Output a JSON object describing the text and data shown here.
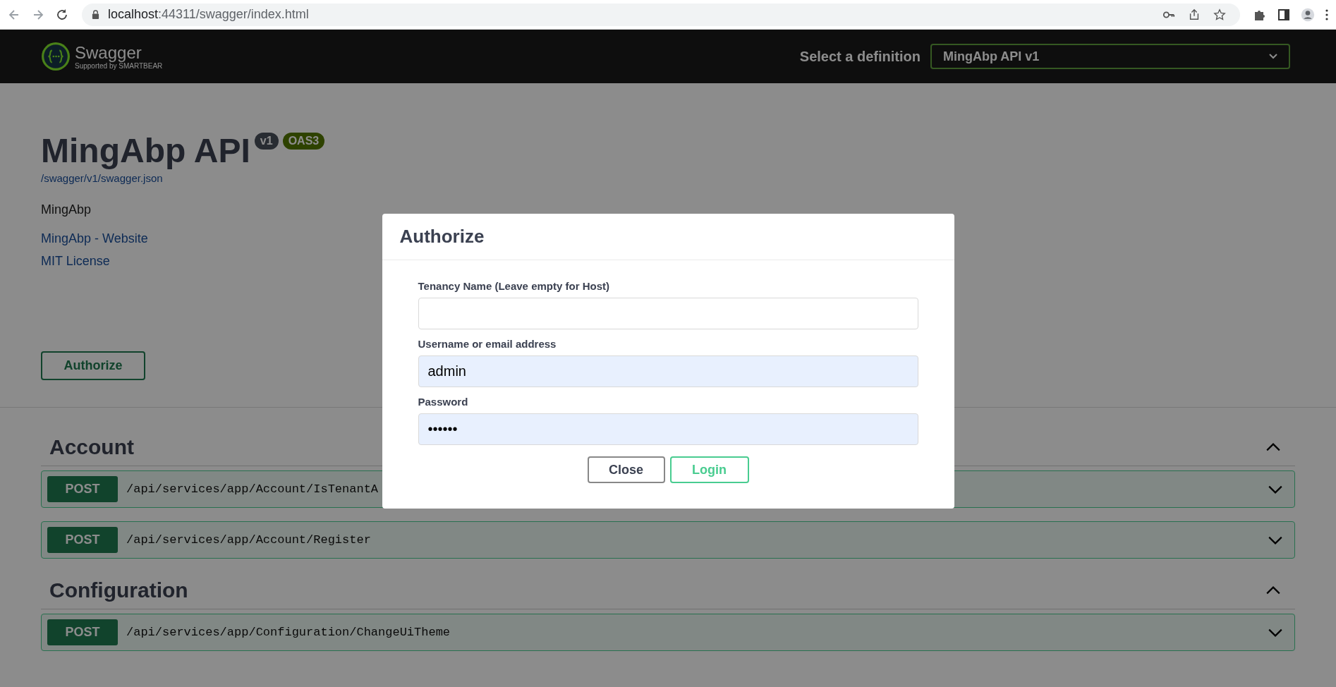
{
  "browser": {
    "url_host": "localhost",
    "url_rest": ":44311/swagger/index.html"
  },
  "header": {
    "logo_text": "Swagger",
    "logo_sub": "Supported by SMARTBEAR",
    "definition_label": "Select a definition",
    "definition_value": "MingAbp API v1"
  },
  "info": {
    "title": "MingAbp API",
    "version": "v1",
    "oas": "OAS3",
    "spec_url": "/swagger/v1/swagger.json",
    "description": "MingAbp",
    "links": [
      "MingAbp - Website",
      "MIT License"
    ],
    "authorize_button": "Authorize"
  },
  "sections": [
    {
      "name": "Account",
      "expanded": true,
      "operations": [
        {
          "method": "POST",
          "path": "/api/services/app/Account/IsTenantA",
          "expanded": false
        },
        {
          "method": "POST",
          "path": "/api/services/app/Account/Register",
          "expanded": false
        }
      ]
    },
    {
      "name": "Configuration",
      "expanded": true,
      "operations": [
        {
          "method": "POST",
          "path": "/api/services/app/Configuration/ChangeUiTheme",
          "expanded": false
        }
      ]
    }
  ],
  "modal": {
    "title": "Authorize",
    "fields": [
      {
        "label": "Tenancy Name (Leave empty for Host)",
        "autofilled": false
      },
      {
        "label": "Username or email address",
        "value": "admin",
        "autofilled": true
      },
      {
        "label": "Password",
        "value": "••••••",
        "autofilled": true
      }
    ],
    "buttons": [
      {
        "label": "Close",
        "kind": "cancel"
      },
      {
        "label": "Login",
        "kind": "submit"
      }
    ]
  }
}
